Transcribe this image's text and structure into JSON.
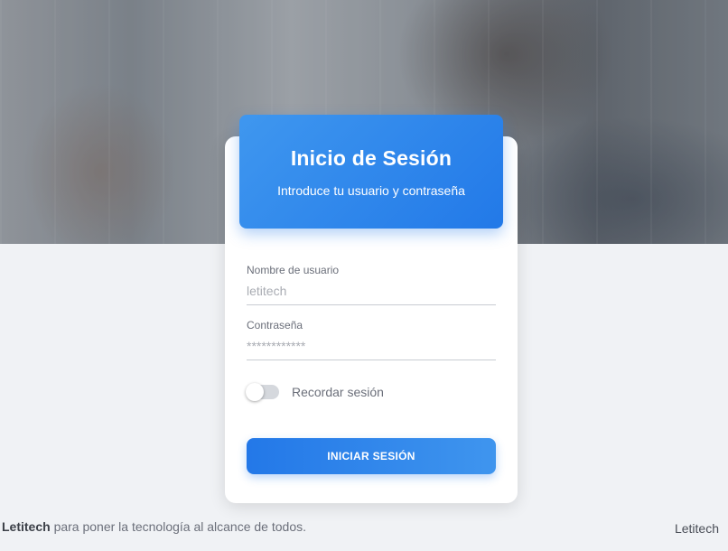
{
  "login": {
    "title": "Inicio de Sesión",
    "subtitle": "Introduce tu usuario y contraseña",
    "username_label": "Nombre de usuario",
    "username_placeholder": "letitech",
    "password_label": "Contraseña",
    "password_placeholder": "************",
    "remember_label": "Recordar sesión",
    "remember_on": false,
    "submit_label": "INICIAR SESIÓN"
  },
  "footer": {
    "brand": "Letitech",
    "tagline": " para poner la tecnología al alcance de todos.",
    "right_text": "Letitech"
  },
  "colors": {
    "accent": "#2378e8",
    "background": "#f0f2f5"
  }
}
